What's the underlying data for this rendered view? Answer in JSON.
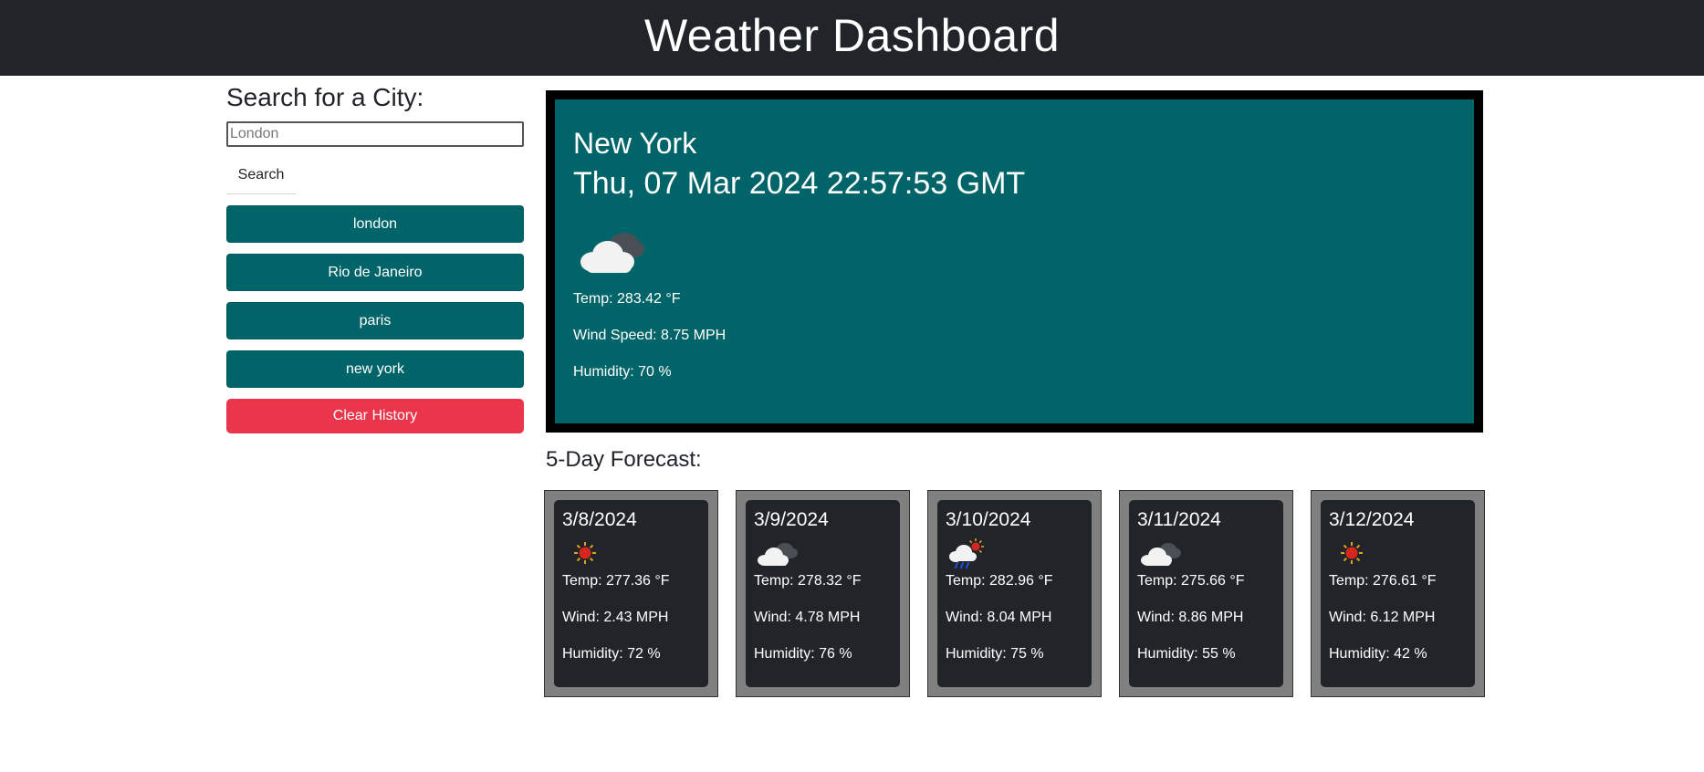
{
  "header": {
    "title": "Weather Dashboard"
  },
  "search": {
    "heading": "Search for a City:",
    "placeholder": "London",
    "button_label": "Search"
  },
  "history": [
    {
      "label": "london"
    },
    {
      "label": "Rio de Janeiro"
    },
    {
      "label": "paris"
    },
    {
      "label": "new york"
    }
  ],
  "clear_label": "Clear History",
  "current": {
    "city": "New York",
    "date": "Thu, 07 Mar 2024 22:57:53 GMT",
    "icon": "cloudy-icon",
    "temp": "Temp: 283.42 °F",
    "wind": "Wind Speed: 8.75 MPH",
    "humidity": "Humidity: 70 %"
  },
  "forecast_title": "5-Day Forecast:",
  "forecast": [
    {
      "date": "3/8/2024",
      "icon": "sun-icon",
      "temp": "Temp: 277.36 °F",
      "wind": "Wind: 2.43 MPH",
      "humidity": "Humidity: 72 %"
    },
    {
      "date": "3/9/2024",
      "icon": "cloudy-icon",
      "temp": "Temp: 278.32 °F",
      "wind": "Wind: 4.78 MPH",
      "humidity": "Humidity: 76 %"
    },
    {
      "date": "3/10/2024",
      "icon": "rain-sun-icon",
      "temp": "Temp: 282.96 °F",
      "wind": "Wind: 8.04 MPH",
      "humidity": "Humidity: 75 %"
    },
    {
      "date": "3/11/2024",
      "icon": "cloudy-icon",
      "temp": "Temp: 275.66 °F",
      "wind": "Wind: 8.86 MPH",
      "humidity": "Humidity: 55 %"
    },
    {
      "date": "3/12/2024",
      "icon": "sun-icon",
      "temp": "Temp: 276.61 °F",
      "wind": "Wind: 6.12 MPH",
      "humidity": "Humidity: 42 %"
    }
  ],
  "colors": {
    "header_bg": "#212529",
    "teal": "#016469",
    "clear_red": "#e9364b",
    "card_gray": "#808080"
  }
}
